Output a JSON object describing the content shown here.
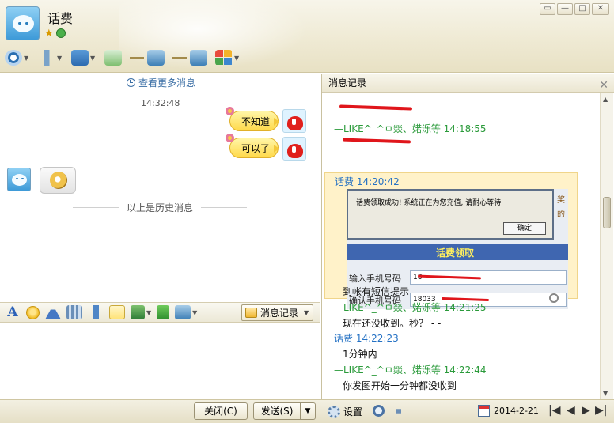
{
  "window": {
    "contact_name": "话费",
    "buttons": {
      "min": "▭",
      "restore": "—",
      "max": "□",
      "close": "✕"
    }
  },
  "top_toolbar": {
    "tools": [
      {
        "name": "video-call",
        "icon": "camera-icon"
      },
      {
        "name": "voice-call",
        "icon": "microphone-icon"
      },
      {
        "name": "send-file",
        "icon": "folder-icon"
      },
      {
        "name": "chat-app",
        "icon": "message-icon"
      },
      {
        "name": "remote-desktop",
        "icon": "screen-icon"
      },
      {
        "name": "share-screen",
        "icon": "screen-share-icon"
      },
      {
        "name": "apps",
        "icon": "grid-icon"
      }
    ]
  },
  "chat": {
    "more_messages": "查看更多消息",
    "timestamp": "14:32:48",
    "messages": [
      {
        "side": "me",
        "text": "不知道"
      },
      {
        "side": "me",
        "text": "可以了"
      },
      {
        "side": "them",
        "text": "",
        "sticker": "ok-hand-sticker"
      }
    ],
    "history_separator": "以上是历史消息"
  },
  "format_toolbar": {
    "font_glyph": "A",
    "history_button": "消息记录"
  },
  "input": {
    "value": ""
  },
  "bottom_bar": {
    "close": "关闭(C)",
    "send": "发送(S)",
    "send_dropdown": "▼",
    "settings": "设置",
    "date": "2014-2-21",
    "nav": [
      "|◀",
      "◀",
      "▶",
      "▶|"
    ]
  },
  "history": {
    "title": "消息记录",
    "entries": [
      {
        "sender": "—LIKE^_^ㅁ燚、婼泺等",
        "time": "14:18:55",
        "text": ""
      },
      {
        "sender": "话费",
        "time": "14:20:42",
        "text": "到帐有短信提示"
      },
      {
        "sender": "—LIKE^_^ㅁ燚、婼泺等",
        "time": "14:21:25",
        "text": "现在还没收到。秒？ - -"
      },
      {
        "sender": "话费",
        "time": "14:22:23",
        "text": "1分钟内"
      },
      {
        "sender": "—LIKE^_^ㅁ燚、婼泺等",
        "time": "14:22:44",
        "text": "你发图开始一分钟都没收到"
      }
    ],
    "screenshot": {
      "dialog_msg": "话费领取成功! 系统正在为您充值, 请耐心等待",
      "dialog_ok": "确定",
      "side_text": [
        "奖",
        "的"
      ],
      "panel_title": "话费领取",
      "label_phone": "输入手机号码",
      "label_confirm": "确认手机号码",
      "phone_value": "18",
      "confirm_value": "18033"
    }
  },
  "colors": {
    "me_name": "#2a9a3a",
    "them_name": "#2471c4",
    "highlight": "#fff2c9",
    "redaction": "#e0161b"
  }
}
